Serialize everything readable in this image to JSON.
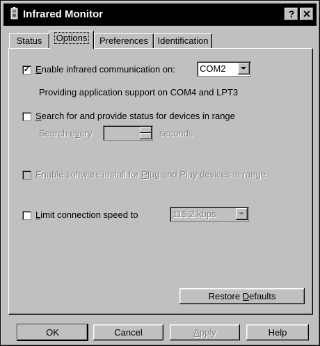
{
  "window": {
    "title": "Infrared Monitor"
  },
  "titlebar": {
    "help_label": "?",
    "close_label": "✕"
  },
  "tabs": [
    {
      "label": "Status"
    },
    {
      "label": "Options"
    },
    {
      "label": "Preferences"
    },
    {
      "label": "Identification"
    }
  ],
  "options": {
    "enable_ir": {
      "checked": true,
      "mark": "✓",
      "prefix": "",
      "accel": "E",
      "rest": "nable infrared communication on:"
    },
    "port_select": {
      "value": "COM2"
    },
    "support_text": "Providing application support on COM4 and LPT3",
    "search_devices": {
      "checked": false,
      "accel": "S",
      "rest": "earch for and provide status for devices in range"
    },
    "search_every": {
      "pre": "Search e",
      "accel": "v",
      "post": "ery",
      "units": "seconds",
      "value": ""
    },
    "software_install": {
      "checked": false,
      "pre": "Enable software install for ",
      "accel": "P",
      "post": "lug and Play devices in range"
    },
    "limit_speed": {
      "checked": false,
      "accel": "L",
      "rest": "imit connection speed to"
    },
    "speed_select": {
      "value": "115.2 kbps"
    },
    "restore_defaults": {
      "pre": "Restore ",
      "accel": "D",
      "post": "efaults"
    }
  },
  "footer": {
    "ok": "OK",
    "cancel": "Cancel",
    "apply": {
      "accel": "A",
      "rest": "pply"
    },
    "help": "Help"
  }
}
